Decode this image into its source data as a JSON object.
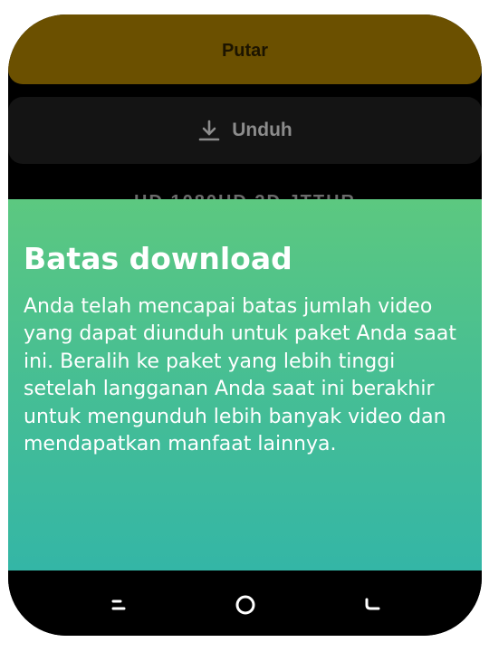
{
  "actions": {
    "play_label": "Putar",
    "download_label": "Unduh",
    "download_icon": "download-icon",
    "obscured_text": "HD 1080HD 2D JTTHR"
  },
  "dialog": {
    "title": "Batas download",
    "message": "Anda telah mencapai batas jumlah video yang dapat diunduh untuk paket Anda saat ini. Beralih ke paket yang lebih tinggi setelah langganan Anda saat ini berakhir untuk mengunduh lebih banyak video dan mendapatkan manfaat lainnya."
  },
  "navbar": {
    "recents_icon": "recents-icon",
    "home_icon": "home-icon",
    "back_icon": "back-icon"
  },
  "colors": {
    "play_button": "#6b5000",
    "download_button": "#141414",
    "sheet_top": "#5cc880",
    "sheet_bottom": "#34b6a6"
  }
}
